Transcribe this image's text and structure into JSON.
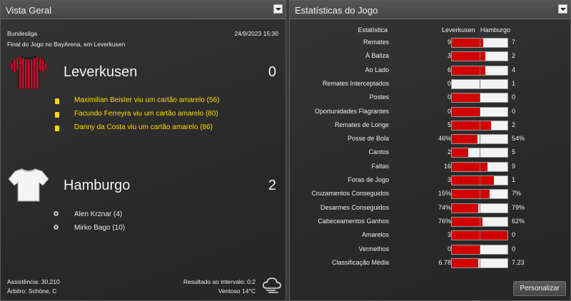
{
  "overview": {
    "title": "Vista Geral",
    "competition": "Bundesliga",
    "datetime": "24/9/2023 15:30",
    "venue": "Final do Jogo no BayArena, em Leverkusen",
    "home": {
      "name": "Leverkusen",
      "score": "0",
      "shirt_color": "#c8102e",
      "events": [
        {
          "type": "yellow-card",
          "text": "Maximilian Beister viu um cartão amarelo (56)"
        },
        {
          "type": "yellow-card",
          "text": "Facundo Ferreyra viu um cartão amarelo (80)"
        },
        {
          "type": "yellow-card",
          "text": "Danny da Costa viu um cartão amarelo (86)"
        }
      ]
    },
    "away": {
      "name": "Hamburgo",
      "score": "2",
      "shirt_color": "#ffffff",
      "events": [
        {
          "type": "goal",
          "text": "Alen Krznar (4)"
        },
        {
          "type": "goal",
          "text": "Mirko Bago (10)"
        }
      ]
    },
    "attendance": "Assistência: 30,210",
    "referee": "Árbitro: Schöne, C",
    "halftime": "Resultado ao intervalo: 0:2",
    "weather": "Ventoso 14°C",
    "weather_icon": "cloud-wind-icon"
  },
  "stats": {
    "title": "Estatísticas do Jogo",
    "col_stat": "Estatística",
    "col_home": "Leverkusen",
    "col_away": "Hamburgo",
    "home_color": "#d20000",
    "away_color": "#f3f3f3",
    "rows": [
      {
        "label": "Remates",
        "home": "9",
        "away": "7",
        "share": 0.56
      },
      {
        "label": "À Baliza",
        "home": "3",
        "away": "2",
        "share": 0.6
      },
      {
        "label": "Ao Lado",
        "home": "6",
        "away": "4",
        "share": 0.6
      },
      {
        "label": "Remates Interceptados",
        "home": "0",
        "away": "1",
        "share": 0.0
      },
      {
        "label": "Postes",
        "home": "0",
        "away": "0",
        "share": 0.5
      },
      {
        "label": "Oportunidades Flagrantes",
        "home": "0",
        "away": "0",
        "share": 0.5
      },
      {
        "label": "Remates de Longe",
        "home": "5",
        "away": "2",
        "share": 0.71
      },
      {
        "label": "Posse de Bola",
        "home": "46%",
        "away": "54%",
        "share": 0.46
      },
      {
        "label": "Cantos",
        "home": "2",
        "away": "5",
        "share": 0.29
      },
      {
        "label": "Faltas",
        "home": "16",
        "away": "9",
        "share": 0.64
      },
      {
        "label": "Foras de Jogo",
        "home": "3",
        "away": "1",
        "share": 0.75
      },
      {
        "label": "Cruzamentos Conseguidos",
        "home": "15%",
        "away": "7%",
        "share": 0.68
      },
      {
        "label": "Desarmes Conseguidos",
        "home": "74%",
        "away": "79%",
        "share": 0.48
      },
      {
        "label": "Cabeceamentos Ganhos",
        "home": "76%",
        "away": "62%",
        "share": 0.55
      },
      {
        "label": "Amarelos",
        "home": "3",
        "away": "0",
        "share": 1.0
      },
      {
        "label": "Vermelhos",
        "home": "0",
        "away": "0",
        "share": 0.5
      },
      {
        "label": "Classificação Média",
        "home": "6.78",
        "away": "7.23",
        "share": 0.48
      }
    ],
    "customize_label": "Personalizar"
  }
}
